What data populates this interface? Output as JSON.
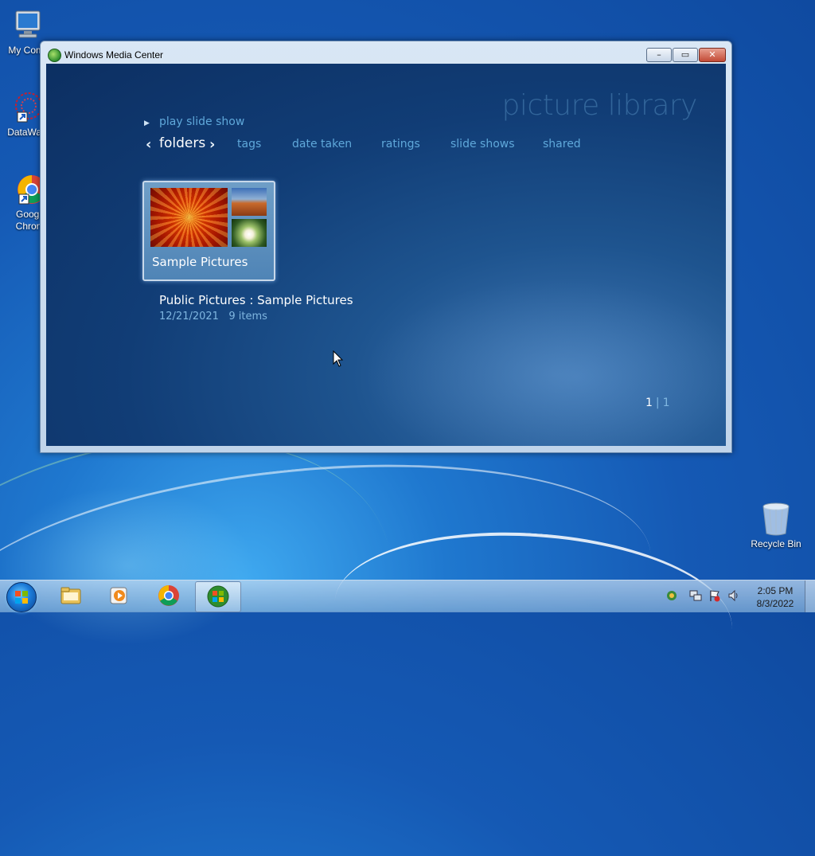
{
  "desktop": {
    "icons": [
      {
        "label": "My Comp"
      },
      {
        "label": "DataWag"
      },
      {
        "label": "Googl",
        "label2": "Chron"
      },
      {
        "label": "Recycle Bin"
      }
    ]
  },
  "window": {
    "title": "Windows Media Center",
    "controls": {
      "minimize": "–",
      "maximize": "▭",
      "close": "✕"
    }
  },
  "media_center": {
    "library_title": "picture library",
    "play_slide_show": "play slide show",
    "nav": {
      "current": "folders",
      "items": [
        "tags",
        "date taken",
        "ratings",
        "slide shows",
        "shared"
      ]
    },
    "tile": {
      "label": "Sample Pictures"
    },
    "info": {
      "title": "Public Pictures : Sample Pictures",
      "date": "12/21/2021",
      "count": "9 items"
    },
    "pager": {
      "current": "1",
      "separator": "|",
      "total": "1"
    }
  },
  "taskbar": {
    "clock": {
      "time": "2:05 PM",
      "date": "8/3/2022"
    }
  }
}
